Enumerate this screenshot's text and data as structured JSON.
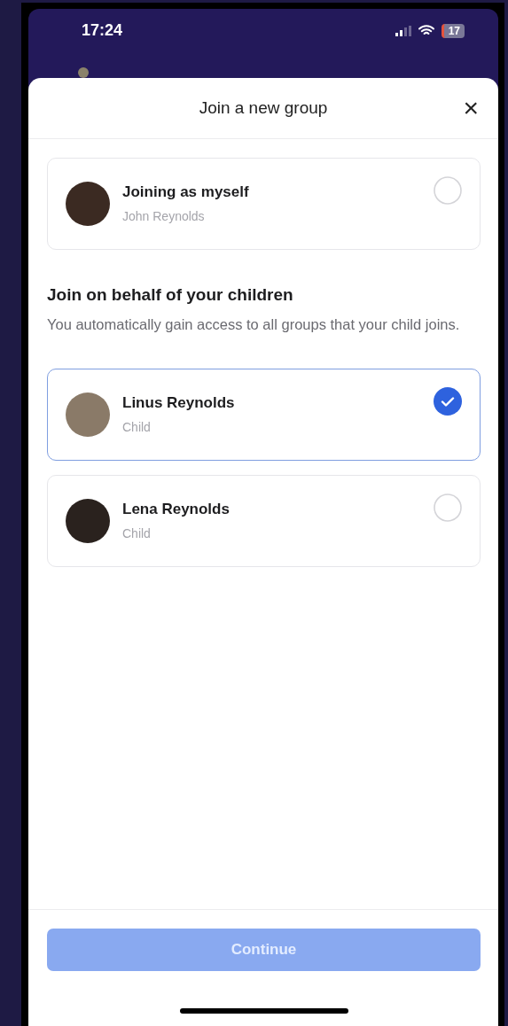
{
  "status_bar": {
    "time": "17:24",
    "battery": "17"
  },
  "sheet": {
    "title": "Join a new group",
    "close": "×"
  },
  "self_option": {
    "title": "Joining as myself",
    "subtitle": "John Reynolds",
    "selected": false
  },
  "children_section": {
    "heading": "Join on behalf of your children",
    "description": "You automatically gain access to all groups that your child joins."
  },
  "children": [
    {
      "name": "Linus Reynolds",
      "role": "Child",
      "selected": true
    },
    {
      "name": "Lena Reynolds",
      "role": "Child",
      "selected": false
    }
  ],
  "continue_button": {
    "label": "Continue",
    "disabled": true
  }
}
